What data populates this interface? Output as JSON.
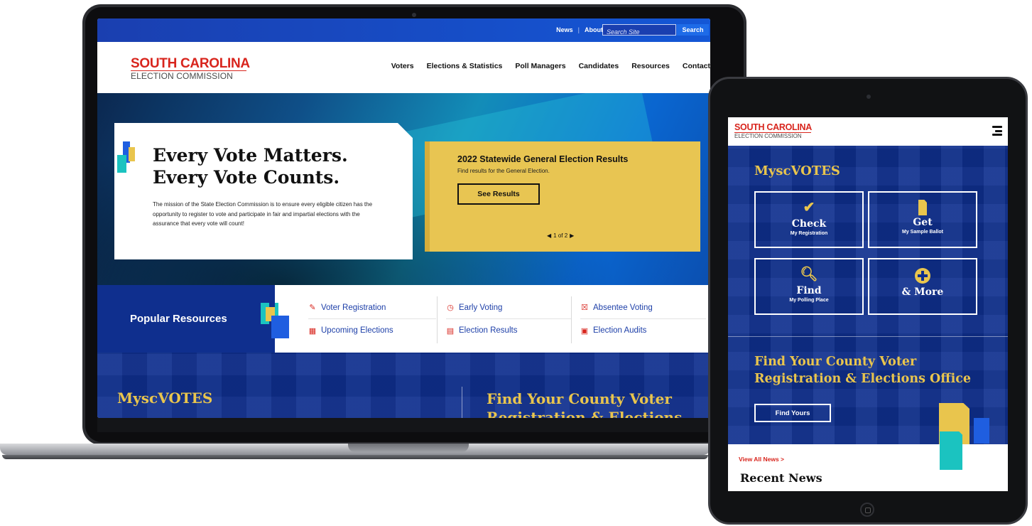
{
  "desktop": {
    "toplinks": {
      "news": "News",
      "separator": "|",
      "about": "About SEC"
    },
    "search": {
      "placeholder": "Search Site",
      "button": "Search"
    },
    "logo": {
      "line1": "SOUTH CAROLINA",
      "line2": "ELECTION COMMISSION"
    },
    "nav": [
      "Voters",
      "Elections & Statistics",
      "Poll Managers",
      "Candidates",
      "Resources",
      "Contact"
    ],
    "hero": {
      "heading_line1": "Every Vote Matters.",
      "heading_line2": "Every Vote Counts.",
      "body": "The mission of the State Election Commission is to ensure every eligible citizen has the opportunity to register to vote and participate in fair and impartial elections with the assurance that every vote will count!"
    },
    "slide": {
      "title": "2022 Statewide General Election Results",
      "subtitle": "Find results for the General Election.",
      "button": "See Results",
      "pager": "1 of 2"
    },
    "popular": {
      "title": "Popular Resources",
      "items": [
        {
          "label": "Voter Registration",
          "icon": "pencil-icon"
        },
        {
          "label": "Upcoming Elections",
          "icon": "calendar-icon"
        },
        {
          "label": "Early Voting",
          "icon": "clock-icon"
        },
        {
          "label": "Election Results",
          "icon": "results-icon"
        },
        {
          "label": "Absentee Voting",
          "icon": "ballot-box-icon"
        },
        {
          "label": "Election Audits",
          "icon": "audit-icon"
        }
      ]
    },
    "bottom": {
      "myscvotes": "MyscVOTES",
      "county": "Find Your County Voter Registration & Elections"
    }
  },
  "tablet": {
    "logo": {
      "line1": "SOUTH CAROLINA",
      "line2": "ELECTION COMMISSION"
    },
    "myscvotes": "MyscVOTES",
    "tiles": [
      {
        "title": "Check",
        "sub": "My Registration",
        "icon": "checkmark-icon"
      },
      {
        "title": "Get",
        "sub": "My Sample Ballot",
        "icon": "ballot-icon"
      },
      {
        "title": "Find",
        "sub": "My Polling Place",
        "icon": "magnifier-icon"
      },
      {
        "title": "& More",
        "sub": "",
        "icon": "plus-circle-icon"
      }
    ],
    "county": "Find Your County Voter Registration & Elections Office",
    "find_button": "Find Yours",
    "view_all": "View All News >",
    "recent_news": "Recent News"
  },
  "colors": {
    "brand_red": "#d8251d",
    "navy": "#0f2f8e",
    "gold": "#e9c54d",
    "teal": "#1bc3c0",
    "blue": "#1f5ee0"
  }
}
